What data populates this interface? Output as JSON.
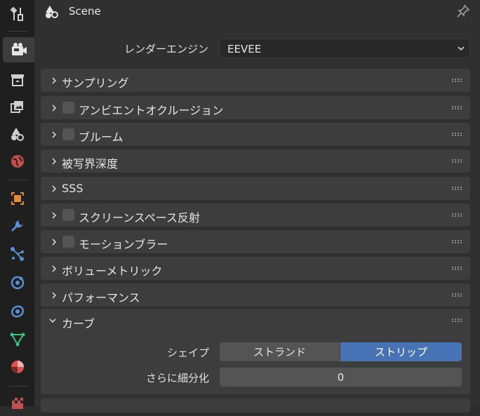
{
  "header": {
    "title": "Scene"
  },
  "render": {
    "engine_label": "レンダーエンジン",
    "engine_value": "EEVEE"
  },
  "panels": [
    {
      "label": "サンプリング",
      "checkbox": false
    },
    {
      "label": "アンビエントオクルージョン",
      "checkbox": true
    },
    {
      "label": "ブルーム",
      "checkbox": true
    },
    {
      "label": "被写界深度",
      "checkbox": false
    },
    {
      "label": "SSS",
      "checkbox": false
    },
    {
      "label": "スクリーンスペース反射",
      "checkbox": true
    },
    {
      "label": "モーションブラー",
      "checkbox": true
    },
    {
      "label": "ボリューメトリック",
      "checkbox": false
    },
    {
      "label": "パフォーマンス",
      "checkbox": false
    }
  ],
  "curves": {
    "label": "カーブ",
    "shape_label": "シェイプ",
    "shape_options": [
      "ストランド",
      "ストリップ"
    ],
    "shape_selected": "ストリップ",
    "subdivide_label": "さらに細分化",
    "subdivide_value": "0"
  },
  "tabs": [
    "tool-icon",
    "render-icon",
    "output-icon",
    "view-layer-icon",
    "scene-icon",
    "world-icon",
    "object-icon",
    "modifier-icon",
    "particles-icon",
    "physics-icon",
    "constraints-icon",
    "data-icon",
    "material-icon",
    "texture-icon"
  ],
  "colors": {
    "accent": "#4772b3",
    "panel": "#3d3d3d",
    "background": "#303030"
  }
}
